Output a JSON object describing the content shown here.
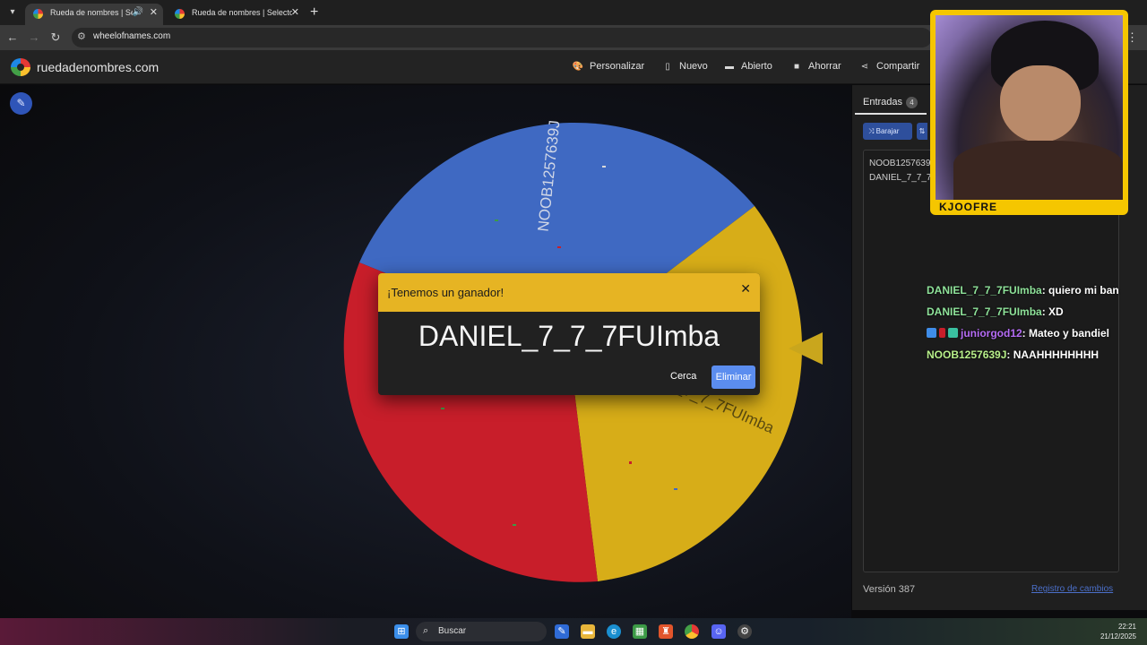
{
  "browser": {
    "tabs": [
      {
        "title": "Rueda de nombres | Selecto",
        "active": true
      },
      {
        "title": "Rueda de nombres | Selector d",
        "active": false
      }
    ],
    "url": "wheelofnames.com"
  },
  "site": {
    "brand": "ruedadenombres.com",
    "menu": [
      {
        "label": "Personalizar",
        "icon": "palette-icon"
      },
      {
        "label": "Nuevo",
        "icon": "file-icon"
      },
      {
        "label": "Abierto",
        "icon": "folder-icon"
      },
      {
        "label": "Ahorrar",
        "icon": "save-icon"
      },
      {
        "label": "Compartir",
        "icon": "share-icon"
      }
    ]
  },
  "wheel": {
    "segment_labels": [
      "NOOB1257639J",
      "_7_7_7FUImba"
    ],
    "colors": {
      "blue": "#3f69c2",
      "yellow": "#d7ad18",
      "red": "#c81e2a",
      "green": "#3c9a46"
    }
  },
  "dialog": {
    "title": "¡Tenemos un ganador!",
    "winner": "DANIEL_7_7_7FUImba",
    "close_label": "Cerca",
    "remove_label": "Eliminar"
  },
  "sidebar": {
    "tab_label": "Entradas",
    "count": "4",
    "shuffle_label": "Barajar",
    "entries": [
      "NOOB1257639J",
      "DANIEL_7_7_7FUImba"
    ],
    "version": "Versión 387",
    "changelog": "Registro de cambios"
  },
  "overlay": {
    "cam_label": "KJOOFRE",
    "chat": [
      {
        "user": "DANIEL_7_7_7FUImba",
        "text": ": quiero mi ban"
      },
      {
        "user": "DANIEL_7_7_7FUImba",
        "text": ": XD"
      },
      {
        "user": "juniorgod12",
        "text": ": Mateo y bandiel"
      },
      {
        "user": "NOOB1257639J",
        "text": ": NAAHHHHHHHH"
      }
    ]
  },
  "taskbar": {
    "search_label": "Buscar",
    "time": "22:21",
    "date": "21/12/2025"
  }
}
